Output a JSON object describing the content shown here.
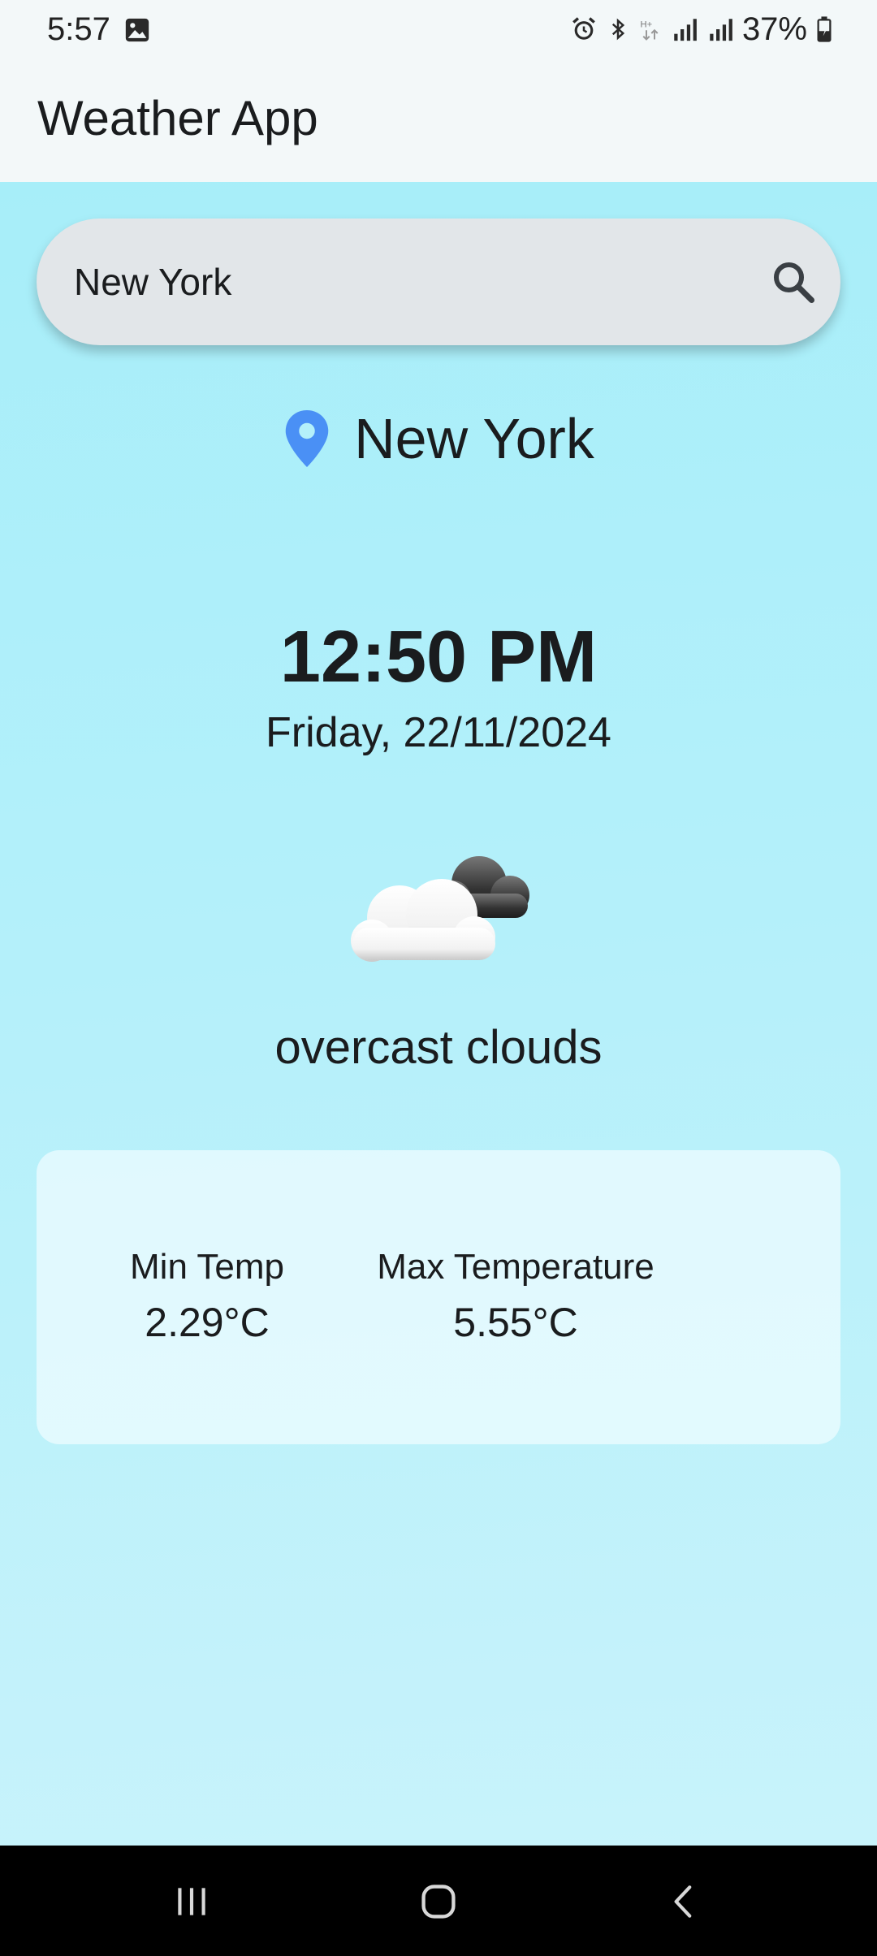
{
  "status_bar": {
    "time": "5:57",
    "battery": "37%",
    "icons": [
      "gallery-icon",
      "alarm-icon",
      "bluetooth-icon",
      "data-h-plus-icon",
      "signal-icon",
      "signal-icon",
      "battery-charging-icon"
    ]
  },
  "app_bar": {
    "title": "Weather App"
  },
  "search": {
    "value": "New York",
    "icon": "search-icon"
  },
  "location": {
    "icon": "location-pin-icon",
    "name": "New York",
    "pin_color": "#4a90f5"
  },
  "datetime": {
    "time": "12:50 PM",
    "date": "Friday, 22/11/2024"
  },
  "weather": {
    "icon": "overcast-clouds-icon",
    "description": "overcast clouds"
  },
  "temperatures": {
    "min_label": "Min Temp",
    "min_value": "2.29°C",
    "max_label": "Max Temperature",
    "max_value": "5.55°C"
  },
  "nav": {
    "icons": [
      "recent-apps-icon",
      "home-icon",
      "back-icon"
    ]
  },
  "colors": {
    "background_top": "#a7eef9",
    "background_bottom": "#c8f3fb",
    "search_bg": "#e2e6e9",
    "app_bar_bg": "#f3f8f9"
  }
}
